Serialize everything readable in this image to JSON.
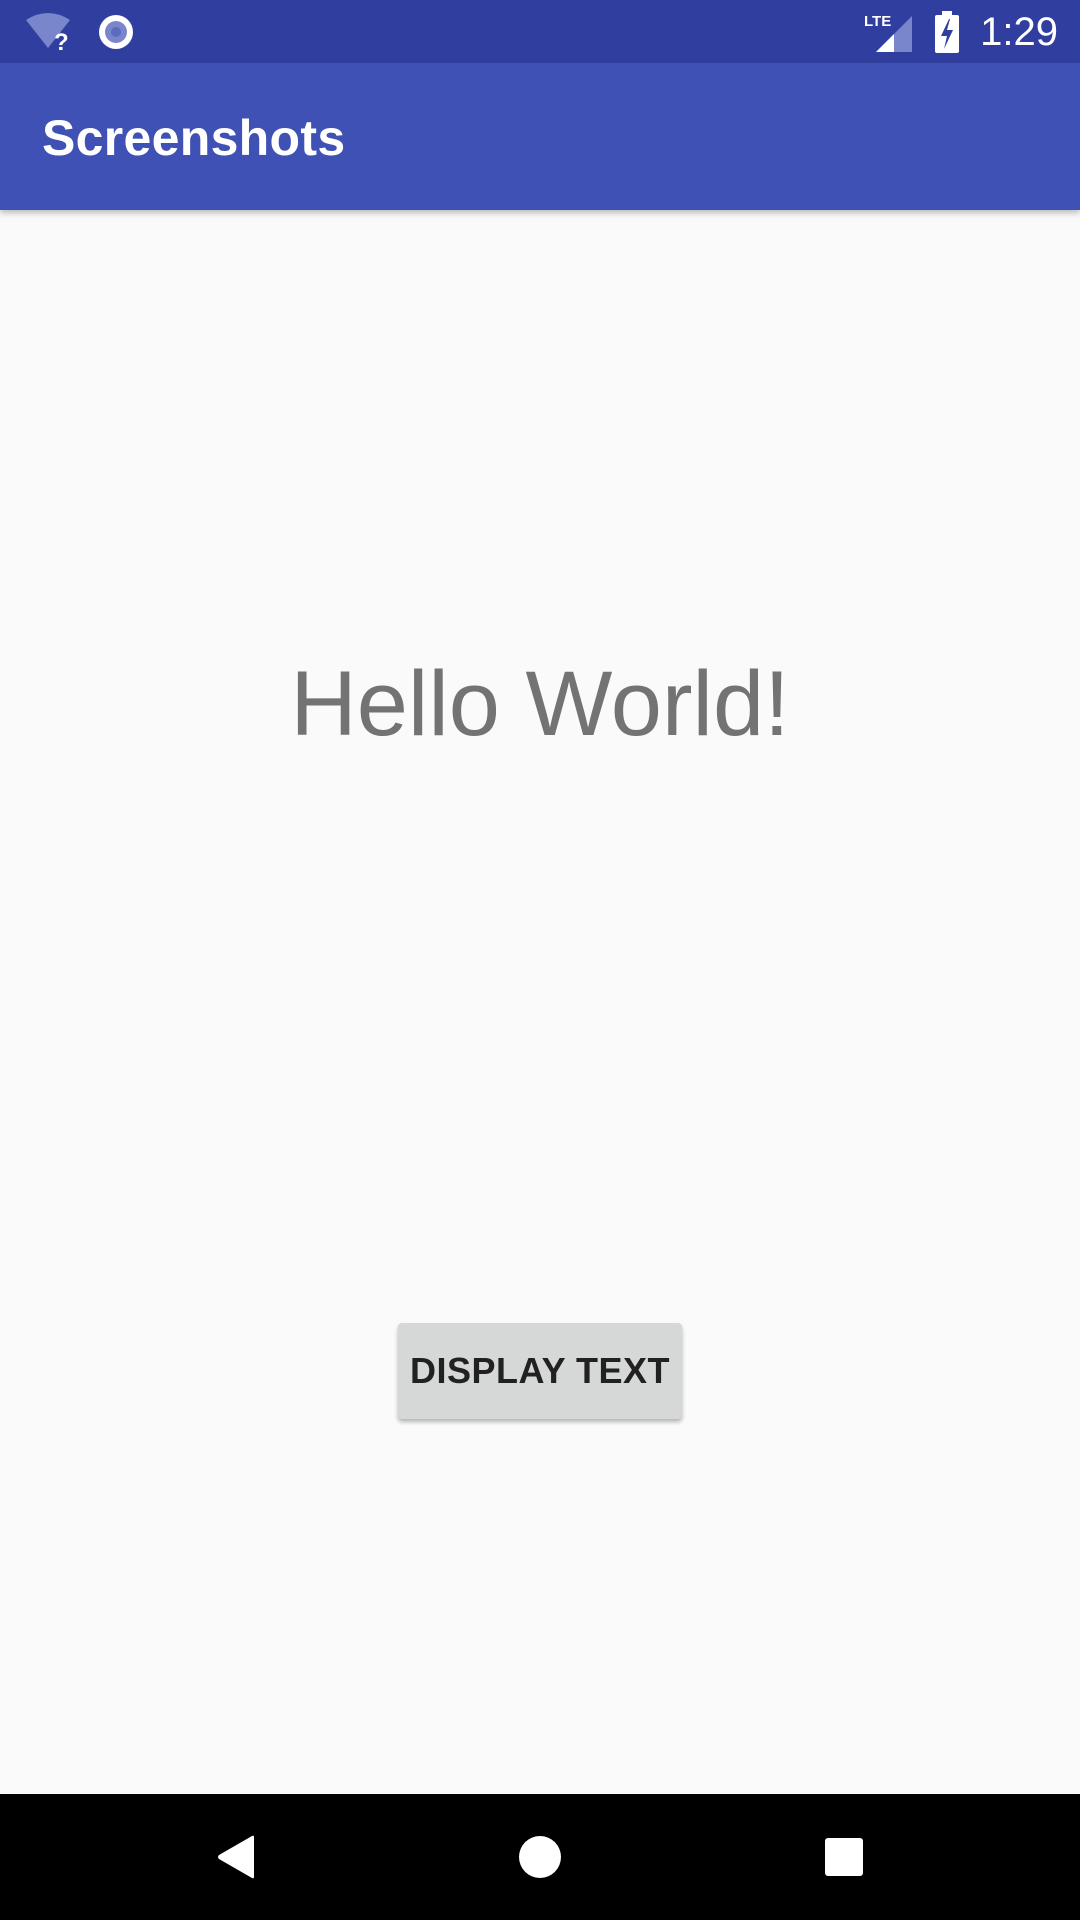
{
  "status_bar": {
    "time": "1:29",
    "network_label": "LTE",
    "icons": [
      "wifi-unknown-icon",
      "sync-circle-icon",
      "lte-signal-icon",
      "battery-charging-icon"
    ],
    "background_color": "#303f9f"
  },
  "app_bar": {
    "title": "Screenshots",
    "background_color": "#3f51b5"
  },
  "main": {
    "greeting": "Hello World!",
    "button_label": "DISPLAY TEXT"
  },
  "nav_bar": {
    "icons": [
      "back-icon",
      "home-icon",
      "recents-icon"
    ]
  }
}
